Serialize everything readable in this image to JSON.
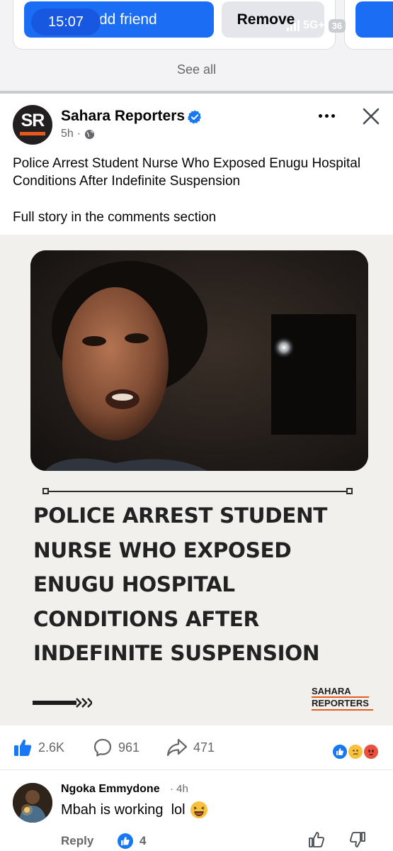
{
  "status_bar": {
    "time": "15:07",
    "network": "5G+",
    "battery": "36"
  },
  "suggestion": {
    "add_friend_label": "Add friend",
    "remove_label": "Remove",
    "see_all_label": "See all"
  },
  "post": {
    "page_name": "Sahara Reporters",
    "avatar_initials": "SR",
    "time": "5h",
    "text_line1": "Police Arrest Student Nurse Who Exposed Enugu Hospital Conditions After Indefinite Suspension",
    "text_line2": "Full story in the comments section",
    "image": {
      "headline_lines": [
        "POLICE ARREST STUDENT",
        "NURSE WHO EXPOSED",
        "ENUGU HOSPITAL",
        "CONDITIONS AFTER",
        "INDEFINITE SUSPENSION"
      ],
      "logo_line1": "SAHARA",
      "logo_line2": "REPORTERS"
    },
    "likes_count": "2.6K",
    "comments_count": "961",
    "shares_count": "471"
  },
  "comment": {
    "author": "Ngoka Emmydone",
    "time": "4h",
    "text": "Mbah is working  lol",
    "reply_label": "Reply",
    "like_count": "4"
  },
  "colors": {
    "brand_blue": "#1b6ef3",
    "sr_orange": "#e8591c",
    "verified_blue": "#1877f2"
  }
}
